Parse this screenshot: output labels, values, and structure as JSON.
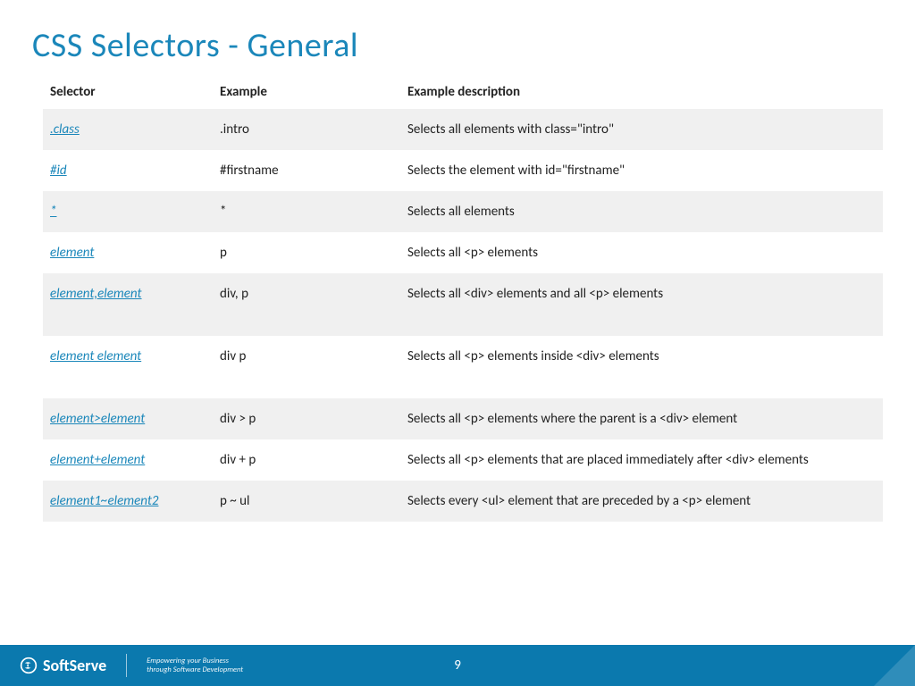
{
  "title": "CSS Selectors - General",
  "columns": [
    "Selector",
    "Example",
    "Example description"
  ],
  "rows": [
    {
      "selector": ".class",
      "example": ".intro",
      "description": "Selects all elements with class=\"intro\""
    },
    {
      "selector": "#id",
      "example": "#firstname",
      "description": "Selects the element with id=\"firstname\""
    },
    {
      "selector": "*",
      "example": "*",
      "description": "Selects all elements"
    },
    {
      "selector": "element",
      "example": "p",
      "description": "Selects all <p> elements"
    },
    {
      "selector": "element,element",
      "example": "div, p",
      "description": "Selects all <div> elements and all <p> elements",
      "tall": true
    },
    {
      "selector": "element element",
      "example": "div p",
      "description": "Selects all <p> elements inside <div> elements",
      "tall": true
    },
    {
      "selector": "element>element",
      "example": "div > p",
      "description": "Selects all <p> elements where the parent is a <div> element"
    },
    {
      "selector": "element+element",
      "example": "div + p",
      "description": "Selects all <p> elements that are placed immediately after <div> elements"
    },
    {
      "selector": "element1~element2",
      "example": "p ~ ul",
      "description": "Selects every <ul> element that are preceded by a <p> element"
    }
  ],
  "footer": {
    "brand": "SoftServe",
    "tagline1": "Empowering your Business",
    "tagline2": "through Software Development",
    "page": "9"
  }
}
